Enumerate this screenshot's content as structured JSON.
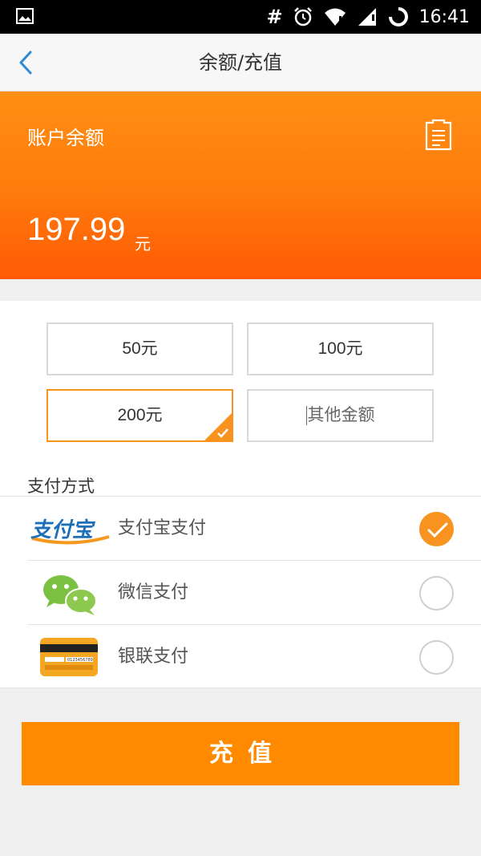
{
  "status_bar": {
    "time": "16:41",
    "hash": "#",
    "icons": [
      "image-icon",
      "alarm-icon",
      "wifi-icon",
      "signal-icon",
      "battery-icon"
    ]
  },
  "nav": {
    "title": "余额/充值",
    "back_icon": "chevron-left-icon"
  },
  "balance": {
    "label": "账户余额",
    "amount": "197.99",
    "unit": "元",
    "bill_icon": "bill-icon"
  },
  "amounts": {
    "options": [
      "50元",
      "100元",
      "200元"
    ],
    "selected": "200元",
    "other_placeholder": "其他金额"
  },
  "payment": {
    "section_title": "支付方式",
    "methods": [
      {
        "label": "支付宝支付",
        "icon": "alipay-icon",
        "logo_text": "支付宝",
        "selected": true
      },
      {
        "label": "微信支付",
        "icon": "wechat-icon",
        "selected": false
      },
      {
        "label": "银联支付",
        "icon": "unionpay-card-icon",
        "card_number": "0123456789",
        "selected": false
      }
    ]
  },
  "submit_label": "充值",
  "colors": {
    "accent": "#ff8a00",
    "header_top": "#ff8f14",
    "header_bottom": "#ff5a04",
    "alipay_blue": "#1e6fb8",
    "wechat_green": "#7ac142"
  }
}
